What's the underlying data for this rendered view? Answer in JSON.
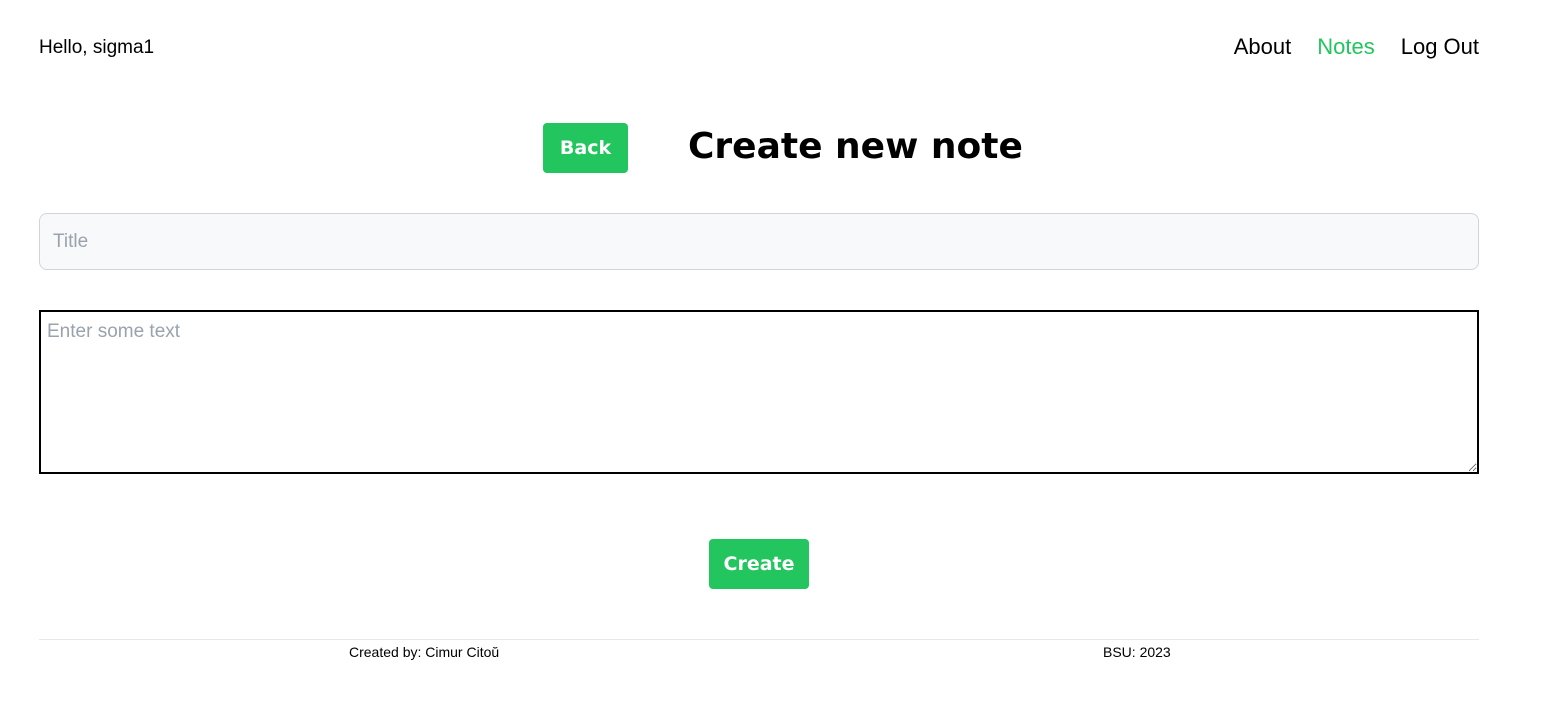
{
  "header": {
    "greeting": "Hello, sigma1",
    "nav": {
      "about": "About",
      "notes": "Notes",
      "logout": "Log Out"
    }
  },
  "main": {
    "back_label": "Back",
    "title": "Create new note",
    "title_input": {
      "placeholder": "Title",
      "value": ""
    },
    "text_input": {
      "placeholder": "Enter some text",
      "value": ""
    },
    "create_label": "Create"
  },
  "footer": {
    "created_by": "Created by: Cimur Citoŭ",
    "org_year": "BSU: 2023"
  },
  "colors": {
    "accent": "#22c55e",
    "input_bg": "#f8f9fb"
  }
}
